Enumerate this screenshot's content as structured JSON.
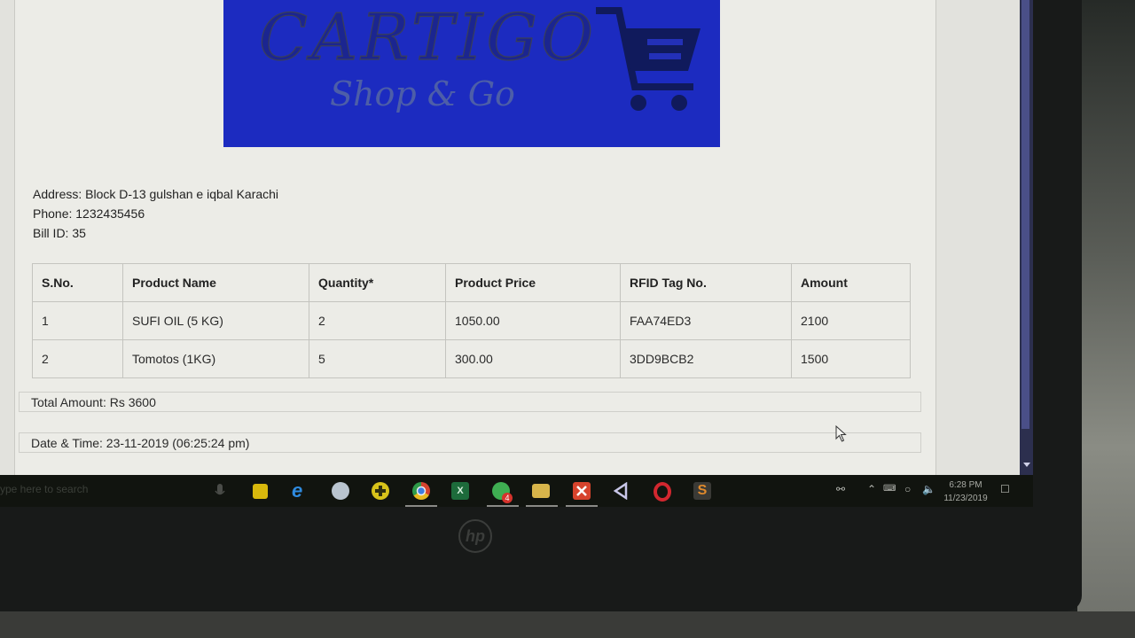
{
  "logo": {
    "brand": "CARTIGO",
    "tagline": "Shop & Go"
  },
  "store": {
    "address": "Address: Block D-13 gulshan e iqbal Karachi",
    "phone": "Phone: 1232435456",
    "bill_id": "Bill ID: 35"
  },
  "table": {
    "headers": [
      "S.No.",
      "Product Name",
      "Quantity*",
      "Product Price",
      "RFID Tag No.",
      "Amount"
    ],
    "rows": [
      [
        "1",
        "SUFI OIL (5 KG)",
        "2",
        "1050.00",
        "FAA74ED3",
        "2100"
      ],
      [
        "2",
        "Tomotos (1KG)",
        "5",
        "300.00",
        "3DD9BCB2",
        "1500"
      ]
    ]
  },
  "total": "Total Amount: Rs 3600",
  "datetime": "Date & Time: 23-11-2019 (06:25:24 pm)",
  "taskbar": {
    "search_placeholder": "ype here to search",
    "whatsapp_badge": "4",
    "time": "6:28 PM",
    "date": "11/23/2019",
    "icons": [
      "microphone-icon",
      "sticky-notes-icon",
      "edge-icon",
      "paint-icon",
      "plus-app-icon",
      "chrome-icon",
      "excel-icon",
      "whatsapp-icon",
      "file-explorer-icon",
      "xampp-icon",
      "visual-studio-icon",
      "opera-icon",
      "sublime-icon"
    ]
  },
  "colors": {
    "banner": "#1c2bc0",
    "scrollbar": "#2c2f4e"
  }
}
